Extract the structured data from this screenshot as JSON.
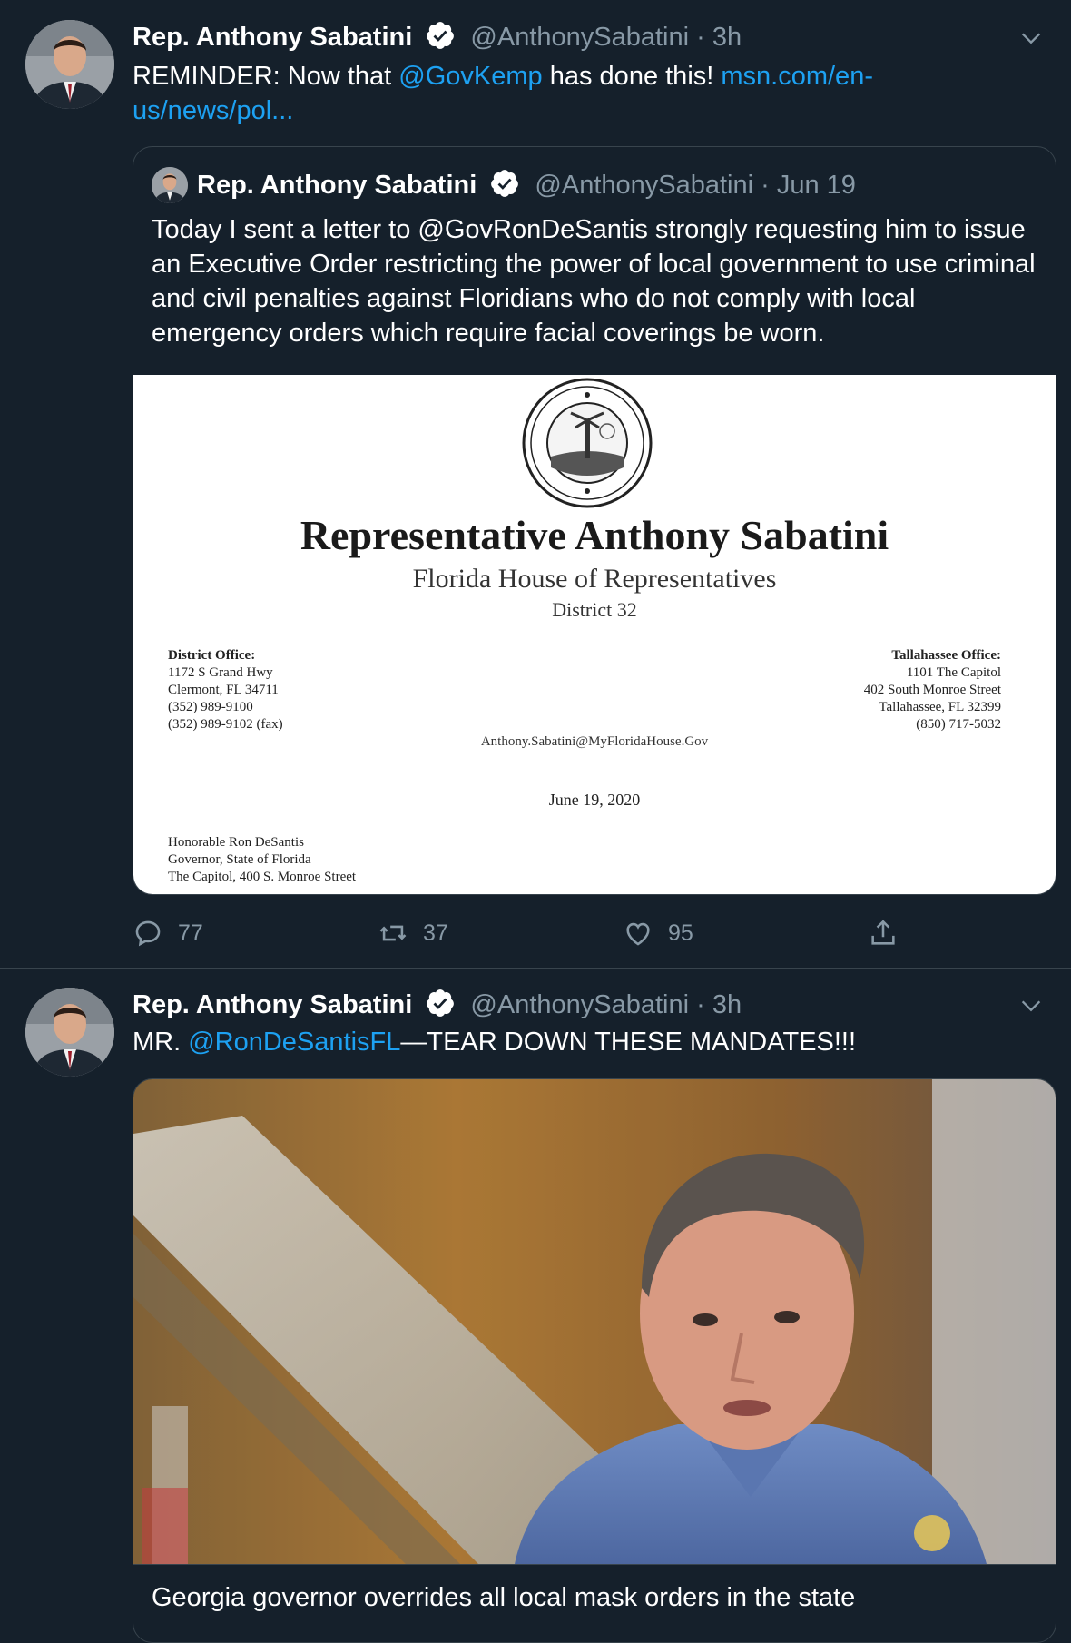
{
  "tweets": [
    {
      "author": {
        "name": "Rep. Anthony Sabatini",
        "handle": "@AnthonySabatini",
        "time": "3h"
      },
      "text_prefix": "REMINDER: Now that ",
      "mention": "@GovKemp",
      "text_mid": " has done this!  ",
      "link_line1": "msn.com/en-",
      "link_line2": "us/news/pol...",
      "quote": {
        "name": "Rep. Anthony Sabatini",
        "handle": "@AnthonySabatini",
        "date": "Jun 19",
        "text": "Today I sent a letter to @GovRonDeSantis strongly requesting him to issue an Executive Order restricting the power of local government to use criminal and civil penalties against Floridians who do not comply with local emergency orders which require facial coverings be worn.",
        "letter": {
          "title": "Representative Anthony Sabatini",
          "subtitle": "Florida House of Representatives",
          "district": "District 32",
          "left_heading": "District Office:",
          "left_lines": [
            "1172 S Grand Hwy",
            "Clermont, FL 34711",
            "(352) 989-9100",
            "(352) 989-9102 (fax)"
          ],
          "right_heading": "Tallahassee Office:",
          "right_lines": [
            "1101 The Capitol",
            "402 South Monroe Street",
            "Tallahassee, FL 32399",
            "(850) 717-5032"
          ],
          "email": "Anthony.Sabatini@MyFloridaHouse.Gov",
          "date": "June 19, 2020",
          "recipient_lines": [
            "Honorable Ron DeSantis",
            "Governor, State of Florida",
            "The Capitol, 400 S. Monroe Street"
          ]
        }
      },
      "stats": {
        "replies": "77",
        "retweets": "37",
        "likes": "95"
      }
    },
    {
      "author": {
        "name": "Rep. Anthony Sabatini",
        "handle": "@AnthonySabatini",
        "time": "3h"
      },
      "text_prefix": "MR. ",
      "mention": "@RonDeSantisFL",
      "text_suffix": "—TEAR DOWN THESE MANDATES!!!",
      "card_title": "Georgia governor overrides all local mask orders in the state"
    }
  ]
}
